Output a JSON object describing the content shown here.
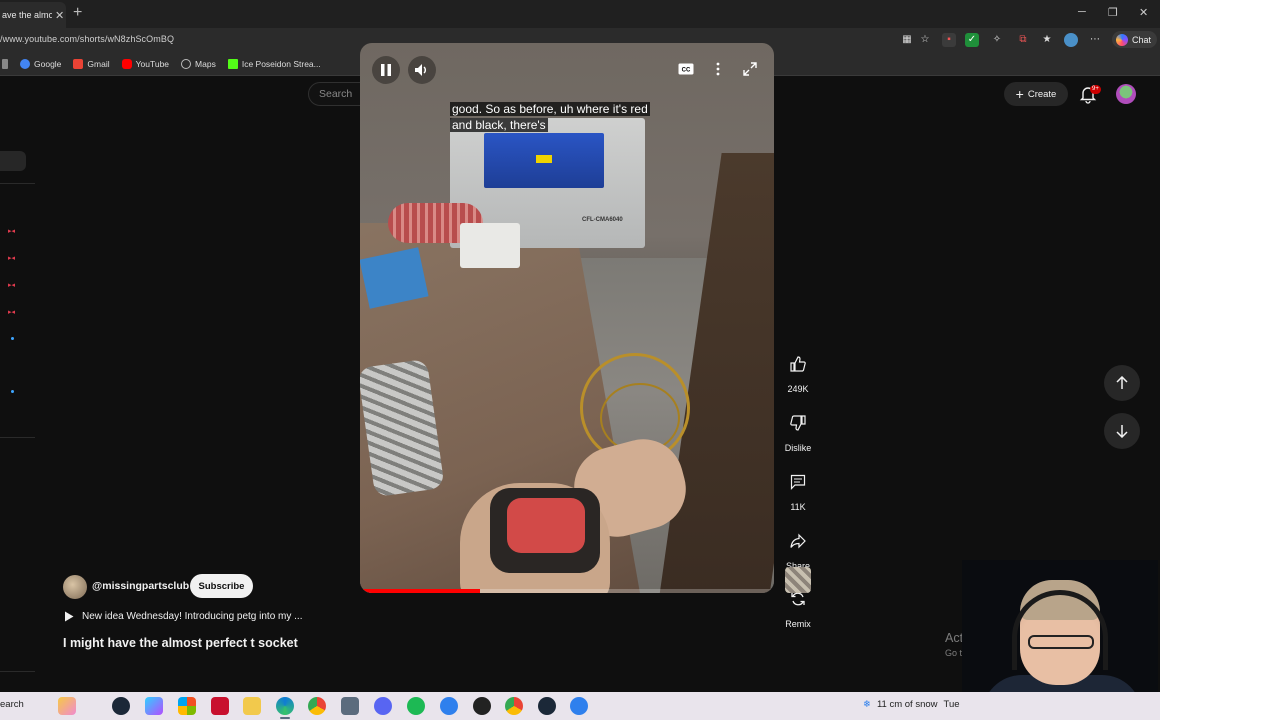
{
  "browser": {
    "tab_title": "ave the almo",
    "url": "/www.youtube.com/shorts/wN8zhScOmBQ",
    "chat_label": "Chat",
    "bookmarks": [
      {
        "label": "Google",
        "icon": "google-icon",
        "color": "#4285f4"
      },
      {
        "label": "Gmail",
        "icon": "gmail-icon",
        "color": "#ea4335"
      },
      {
        "label": "YouTube",
        "icon": "youtube-icon",
        "color": "#ff0000"
      },
      {
        "label": "Maps",
        "icon": "globe-icon",
        "color": "#9aa0a6"
      },
      {
        "label": "Ice Poseidon Strea...",
        "icon": "kick-icon",
        "color": "#53fc18"
      }
    ]
  },
  "youtube": {
    "search_placeholder": "Search",
    "create_label": "Create",
    "notification_badge": "9+"
  },
  "player": {
    "caption_line1": "good. So as before, uh where it's red",
    "caption_line2": "and black, there's",
    "progress": 0.29,
    "machine_label": "CFL-CMA6040"
  },
  "actions": {
    "likes": "249K",
    "dislike_label": "Dislike",
    "comments": "11K",
    "share_label": "Share",
    "remix_label": "Remix"
  },
  "channel": {
    "handle": "@missingpartsclub",
    "subscribe_label": "Subscribe",
    "music_line": "New idea Wednesday! Introducing petg into my ...",
    "short_title": "I might have the almost perfect t socket"
  },
  "watermark": {
    "title": "Activate Wind",
    "subtitle": "Go to Settings to a"
  },
  "taskbar": {
    "search_label": "earch",
    "weather": "11 cm of snow",
    "day": "Tue"
  },
  "colors": {
    "accent_red": "#ff0000",
    "background": "#0f0f0f"
  }
}
